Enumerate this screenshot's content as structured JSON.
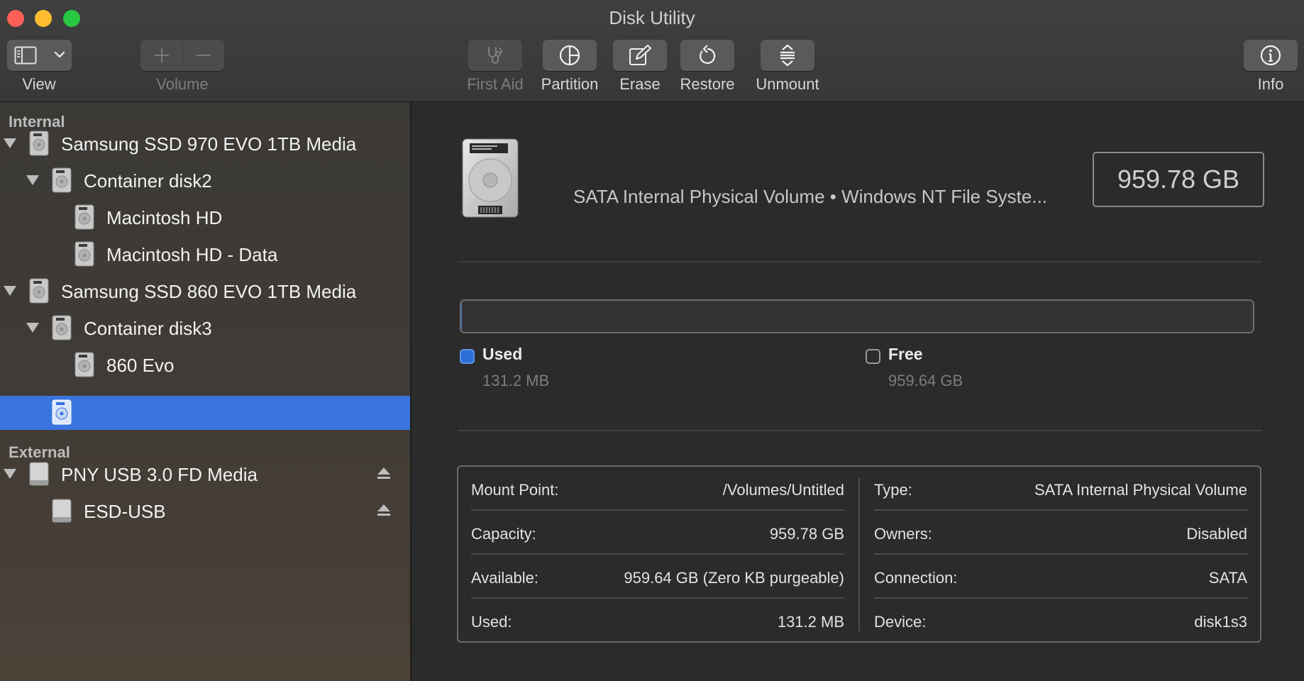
{
  "window": {
    "title": "Disk Utility"
  },
  "toolbar": {
    "view_label": "View",
    "volume_label": "Volume",
    "first_aid_label": "First Aid",
    "partition_label": "Partition",
    "erase_label": "Erase",
    "restore_label": "Restore",
    "unmount_label": "Unmount",
    "info_label": "Info"
  },
  "sidebar": {
    "internal_heading": "Internal",
    "external_heading": "External",
    "internal_items": [
      {
        "label": "Samsung SSD 970 EVO 1TB Media",
        "level": 0,
        "expanded": true
      },
      {
        "label": "Container disk2",
        "level": 1,
        "expanded": true
      },
      {
        "label": "Macintosh HD",
        "level": 2
      },
      {
        "label": "Macintosh HD - Data",
        "level": 2
      },
      {
        "label": "Samsung SSD 860 EVO 1TB Media",
        "level": 0,
        "expanded": true
      },
      {
        "label": "Container disk3",
        "level": 1,
        "expanded": true
      },
      {
        "label": "860 Evo",
        "level": 2
      },
      {
        "label": "",
        "level": 1,
        "selected": true
      }
    ],
    "external_items": [
      {
        "label": "PNY USB 3.0 FD Media",
        "level": 0,
        "expanded": true,
        "ejectable": true
      },
      {
        "label": "ESD-USB",
        "level": 1,
        "ejectable": true
      }
    ]
  },
  "volume": {
    "description": "SATA Internal Physical Volume • Windows NT File Syste...",
    "size": "959.78 GB"
  },
  "usage": {
    "used_fraction": 0.000137,
    "used_label": "Used",
    "used_value": "131.2 MB",
    "free_label": "Free",
    "free_value": "959.64 GB",
    "used_color": "#2d6fd4"
  },
  "info": {
    "mount_point_label": "Mount Point:",
    "mount_point_value": "/Volumes/Untitled",
    "capacity_label": "Capacity:",
    "capacity_value": "959.78 GB",
    "available_label": "Available:",
    "available_value": "959.64 GB (Zero KB purgeable)",
    "used_label": "Used:",
    "used_value": "131.2 MB",
    "type_label": "Type:",
    "type_value": "SATA Internal Physical Volume",
    "owners_label": "Owners:",
    "owners_value": "Disabled",
    "connection_label": "Connection:",
    "connection_value": "SATA",
    "device_label": "Device:",
    "device_value": "disk1s3"
  }
}
